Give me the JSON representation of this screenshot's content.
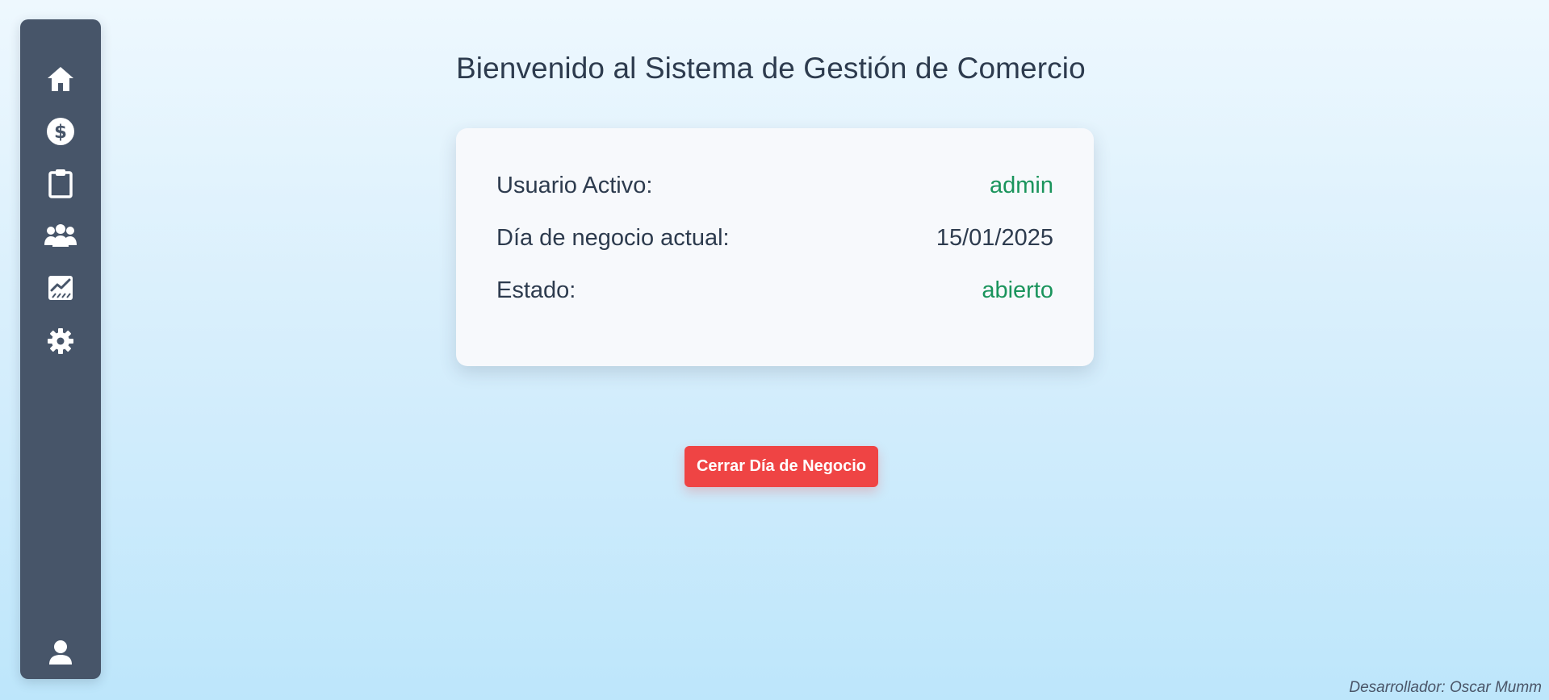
{
  "sidebar": {
    "items": [
      {
        "icon": "home-icon",
        "label": ""
      },
      {
        "icon": "dollar-icon",
        "label": ""
      },
      {
        "icon": "clipboard-icon",
        "label": ""
      },
      {
        "icon": "users-icon",
        "label": ""
      },
      {
        "icon": "chart-icon",
        "label": ""
      },
      {
        "icon": "gear-icon",
        "label": ""
      }
    ],
    "user_icon": "user-icon"
  },
  "main": {
    "title": "Bienvenido al Sistema de Gestión de Comercio",
    "info": [
      {
        "label": "Usuario Activo:",
        "value": "admin"
      },
      {
        "label": "Día de negocio actual:",
        "value": "15/01/2025"
      },
      {
        "label": "Estado:",
        "value": "abierto"
      }
    ],
    "close_button_label": "Cerrar Día de Negocio"
  },
  "footer": {
    "credit": "Desarrollador: Oscar Mumm"
  },
  "colors": {
    "sidebar_bg": "#475569",
    "accent_green": "#1a945c",
    "danger_red": "#ef4444",
    "text_dark": "#2d3b4e"
  }
}
